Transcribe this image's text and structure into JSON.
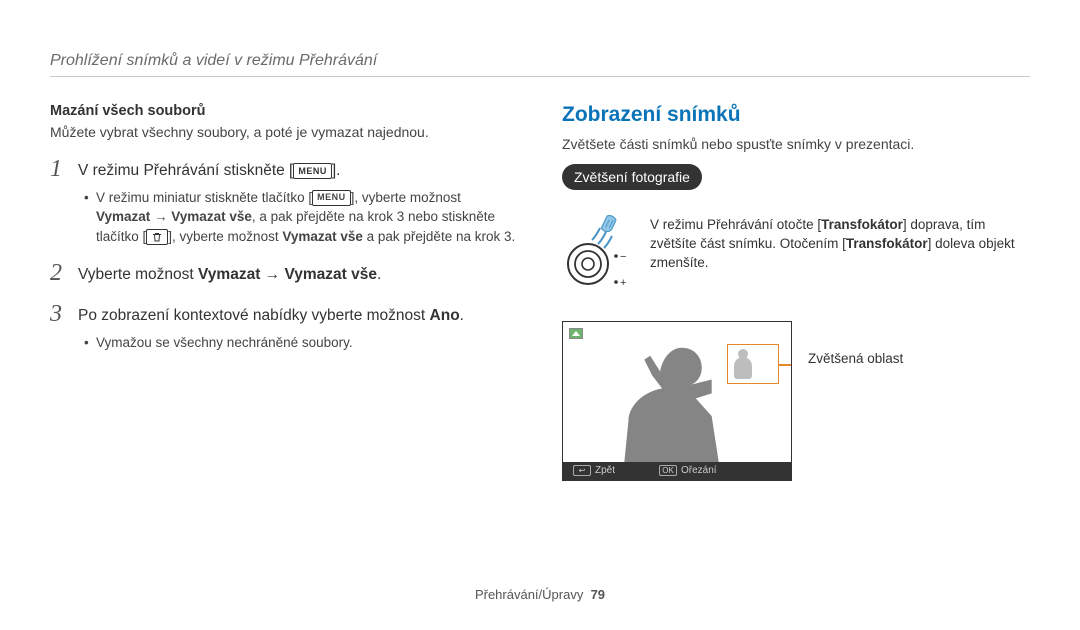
{
  "breadcrumb": "Prohlížení snímků a videí v režimu Přehrávání",
  "left": {
    "subhead": "Mazání všech souborů",
    "intro": "Můžete vybrat všechny soubory, a poté je vymazat najednou.",
    "menu_label": "MENU",
    "steps": {
      "s1": {
        "num": "1",
        "pre": "V režimu Přehrávání stiskněte [",
        "post": "].",
        "bullet_a_pre": "V režimu miniatur stiskněte tlačítko [",
        "bullet_a_mid": "], vyberte možnost ",
        "bullet_a_bold1": "Vymazat",
        "bullet_a_arrow": " → ",
        "bullet_b_bold": "Vymazat vše",
        "bullet_b_mid": ", a pak přejděte na krok 3 nebo stiskněte tlačítko [",
        "bullet_b_post": "], vyberte možnost ",
        "bullet_b_bold2": "Vymazat vše",
        "bullet_b_end": " a pak přejděte na krok 3."
      },
      "s2": {
        "num": "2",
        "pre": "Vyberte možnost ",
        "bold1": "Vymazat",
        "arrow": " → ",
        "bold2": "Vymazat vše",
        "post": "."
      },
      "s3": {
        "num": "3",
        "body": "Po zobrazení kontextové nabídky vyberte možnost ",
        "bold": "Ano",
        "post": ".",
        "bullet": "Vymažou se všechny nechráněné soubory."
      }
    }
  },
  "right": {
    "title": "Zobrazení snímků",
    "intro": "Zvětšete části snímků nebo spusťte snímky v prezentaci.",
    "badge": "Zvětšení fotografie",
    "dial": {
      "minus": "−",
      "plus": "+"
    },
    "side_text_a": "V režimu Přehrávání otočte [",
    "side_bold": "Transfokátor",
    "side_text_b": "] doprava, tím zvětšíte část snímku. Otočením [",
    "side_text_c": "] doleva objekt zmenšíte.",
    "callout_label": "Zvětšená oblast",
    "bottombar": {
      "back": "Zpět",
      "back_icon": "↩",
      "ok": "OK",
      "crop": "Ořezání"
    }
  },
  "footer": {
    "section": "Přehrávání/Úpravy",
    "page": "79"
  }
}
